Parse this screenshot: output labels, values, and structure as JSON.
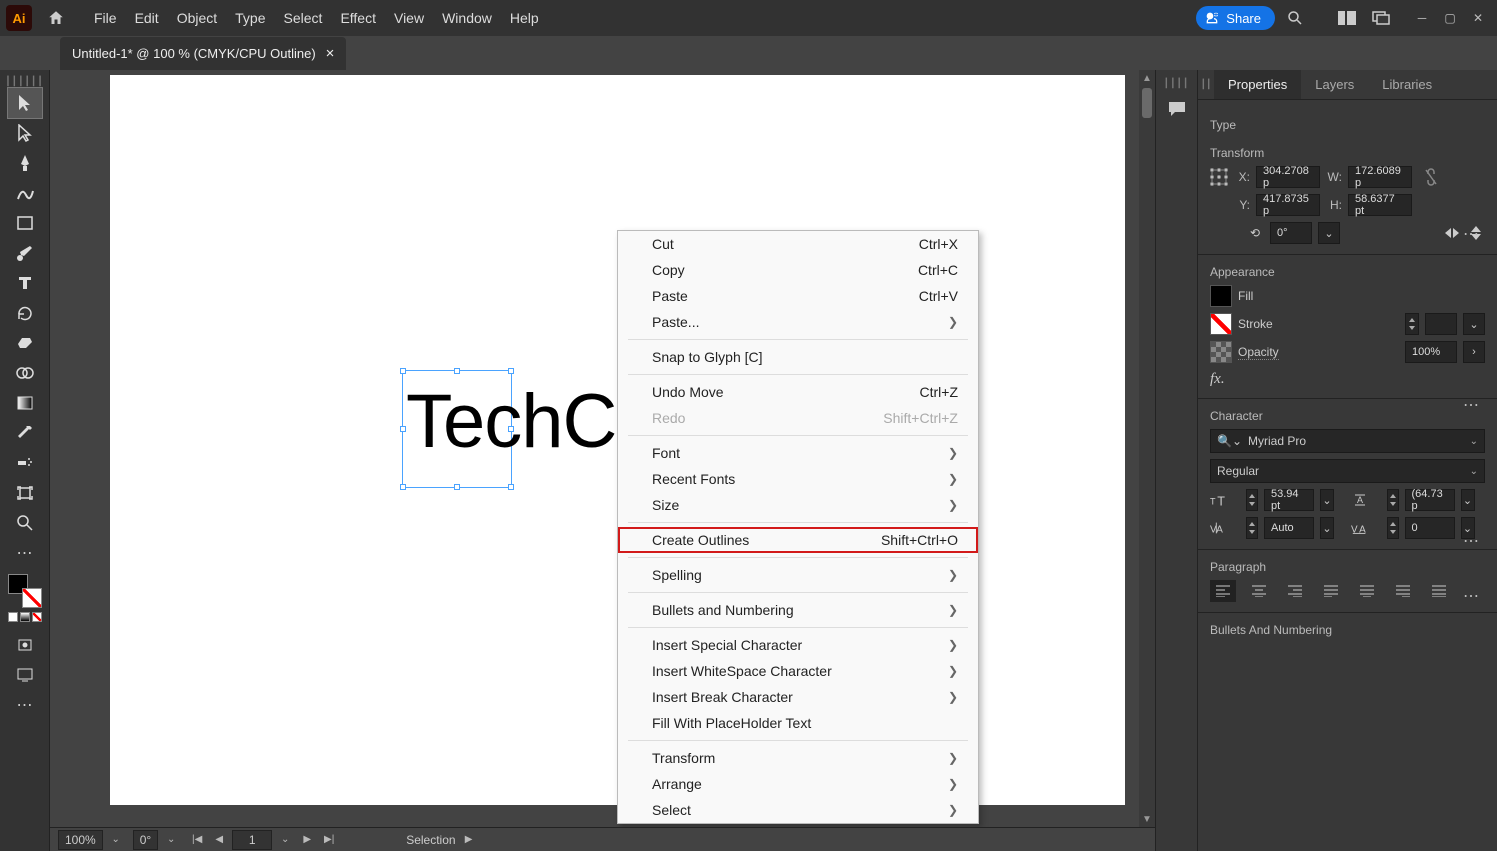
{
  "app": {
    "badge": "Ai"
  },
  "menu": [
    "File",
    "Edit",
    "Object",
    "Type",
    "Select",
    "Effect",
    "View",
    "Window",
    "Help"
  ],
  "share_label": "Share",
  "doc_tab": {
    "title": "Untitled-1* @ 100 % (CMYK/CPU Outline)"
  },
  "canvas_text": "TechC",
  "context_menu": [
    {
      "label": "Cut",
      "shortcut": "Ctrl+X"
    },
    {
      "label": "Copy",
      "shortcut": "Ctrl+C"
    },
    {
      "label": "Paste",
      "shortcut": "Ctrl+V"
    },
    {
      "label": "Paste...",
      "submenu": true
    },
    {
      "sep": true
    },
    {
      "label": "Snap to Glyph [C]"
    },
    {
      "sep": true
    },
    {
      "label": "Undo Move",
      "shortcut": "Ctrl+Z"
    },
    {
      "label": "Redo",
      "shortcut": "Shift+Ctrl+Z",
      "disabled": true
    },
    {
      "sep": true
    },
    {
      "label": "Font",
      "submenu": true
    },
    {
      "label": "Recent Fonts",
      "submenu": true
    },
    {
      "label": "Size",
      "submenu": true
    },
    {
      "sep": true
    },
    {
      "label": "Create Outlines",
      "shortcut": "Shift+Ctrl+O",
      "highlighted": true
    },
    {
      "sep": true
    },
    {
      "label": "Spelling",
      "submenu": true
    },
    {
      "sep": true
    },
    {
      "label": "Bullets and Numbering",
      "submenu": true
    },
    {
      "sep": true
    },
    {
      "label": "Insert Special Character",
      "submenu": true
    },
    {
      "label": "Insert WhiteSpace Character",
      "submenu": true
    },
    {
      "label": "Insert Break Character",
      "submenu": true
    },
    {
      "label": "Fill With PlaceHolder Text"
    },
    {
      "sep": true
    },
    {
      "label": "Transform",
      "submenu": true
    },
    {
      "label": "Arrange",
      "submenu": true
    },
    {
      "label": "Select",
      "submenu": true
    }
  ],
  "panel_tabs": [
    "Properties",
    "Layers",
    "Libraries"
  ],
  "panel": {
    "type_label": "Type",
    "transform": {
      "title": "Transform",
      "x_label": "X:",
      "x": "304.2708 p",
      "y_label": "Y:",
      "y": "417.8735 p",
      "w_label": "W:",
      "w": "172.6089 p",
      "h_label": "H:",
      "h": "58.6377 pt",
      "rotate": "0°"
    },
    "appearance": {
      "title": "Appearance",
      "fill_label": "Fill",
      "stroke_label": "Stroke",
      "opacity_label": "Opacity",
      "opacity_value": "100%"
    },
    "character": {
      "title": "Character",
      "font": "Myriad Pro",
      "style": "Regular",
      "size": "53.94 pt",
      "leading": "(64.73 p",
      "kerning": "Auto",
      "tracking": "0"
    },
    "paragraph": {
      "title": "Paragraph"
    },
    "bullets": {
      "title": "Bullets And Numbering"
    }
  },
  "status": {
    "zoom": "100%",
    "rotate": "0°",
    "page": "1",
    "mode": "Selection"
  }
}
